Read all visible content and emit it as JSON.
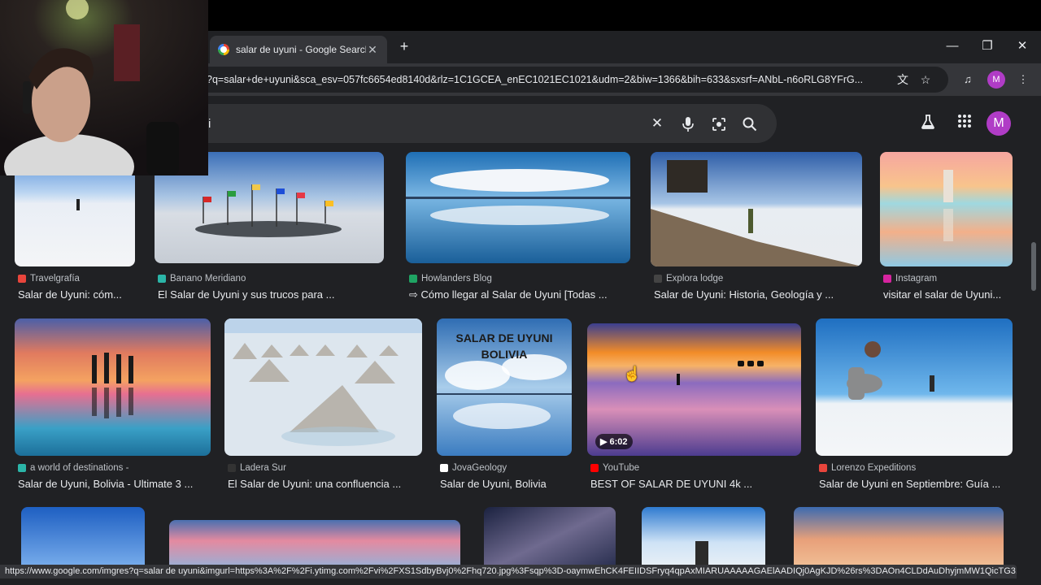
{
  "browser": {
    "tab_title": "salar de uyuni - Google Search",
    "tab_close": "✕",
    "new_tab": "+",
    "url": "?q=salar+de+uyuni&sca_esv=057fc6654ed8140d&rlz=1C1GCEA_enEC1021EC1021&udm=2&biw=1366&bih=633&sxsrf=ANbL-n6oRLG8YFrG...",
    "profile_initial": "M",
    "status_url": "https://www.google.com/imgres?q=salar de uyuni&imgurl=https%3A%2F%2Fi.ytimg.com%2Fvi%2FXS1SdbyBvj0%2Fhq720.jpg%3Fsqp%3D-oaymwEhCK4FEIIDSFryq4qpAxMIARUAAAAAGAElAADIQj0AgKJD%26rs%3DAOn4CLDdAuDhyjmMW1QicTG3..."
  },
  "search": {
    "query": "i",
    "account_initial": "M"
  },
  "results": [
    {
      "source": "Travelgrafía",
      "title": "Salar de Uyuni: cóm...",
      "fav": "#e8453c"
    },
    {
      "source": "Banano Meridiano",
      "title": "El Salar de Uyuni y sus trucos para ...",
      "fav": "#2bb5a8"
    },
    {
      "source": "Howlanders Blog",
      "title": "⇨ Cómo llegar al Salar de Uyuni [Todas ...",
      "fav": "#1fa463"
    },
    {
      "source": "Explora lodge",
      "title": "Salar de Uyuni: Historia, Geología y ...",
      "fav": "#444444"
    },
    {
      "source": "Instagram",
      "title": "visitar el salar de Uyuni...",
      "fav": "#d6249f"
    },
    {
      "source": "a world of destinations -",
      "title": "Salar de Uyuni, Bolivia - Ultimate 3 ...",
      "fav": "#2bb5a8"
    },
    {
      "source": "Ladera Sur",
      "title": "El Salar de Uyuni: una confluencia ...",
      "fav": "#333333"
    },
    {
      "source": "JovaGeology",
      "title": "Salar de Uyuni, Bolivia",
      "fav": "#ffffff"
    },
    {
      "source": "YouTube",
      "title": "BEST OF SALAR DE UYUNI 4k ...",
      "fav": "#ff0000"
    },
    {
      "source": "Lorenzo Expeditions",
      "title": "Salar de Uyuni en Septiembre: Guía ...",
      "fav": "#e8453c"
    }
  ],
  "thumb_text": {
    "jova_overlay_line1": "SALAR DE UYUNI",
    "jova_overlay_line2": "BOLIVIA"
  },
  "video_duration": "6:02"
}
